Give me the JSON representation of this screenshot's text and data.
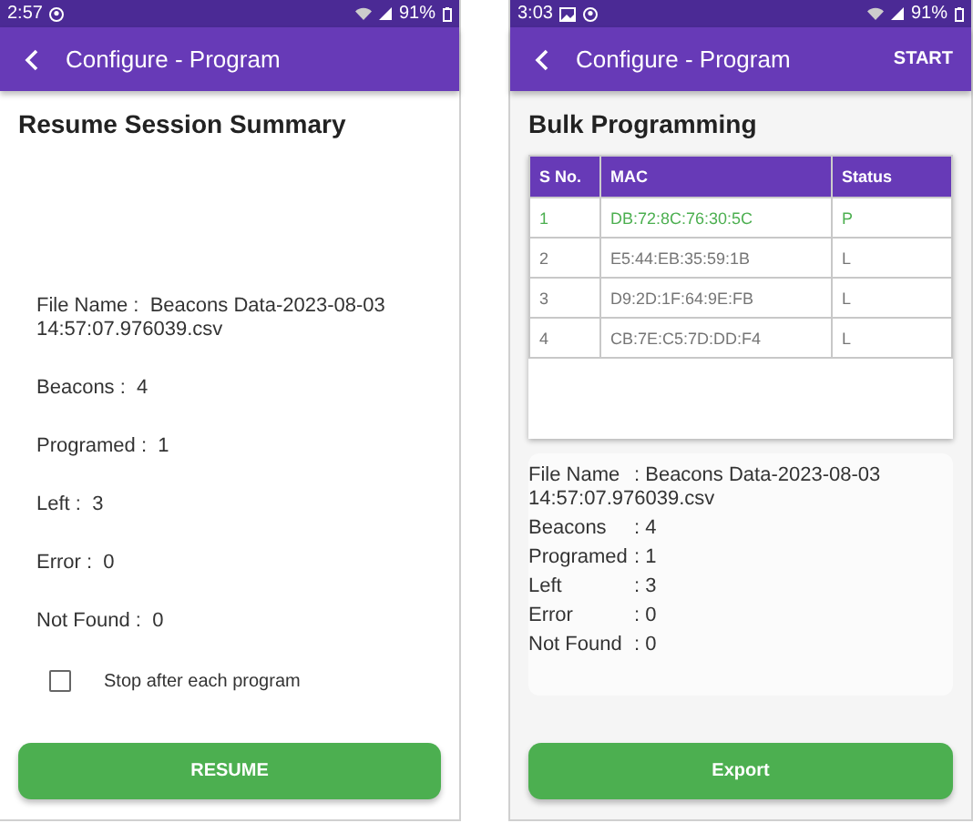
{
  "left_screen": {
    "status_bar": {
      "time": "2:57",
      "battery": "91%"
    },
    "app_bar": {
      "title": "Configure - Program"
    },
    "heading": "Resume Session Summary",
    "summary": [
      {
        "label": "File Name :",
        "value": "Beacons Data-2023-08-03 14:57:07.976039.csv"
      },
      {
        "label": "Beacons :",
        "value": "4"
      },
      {
        "label": "Programed :",
        "value": "1"
      },
      {
        "label": "Left :",
        "value": "3"
      },
      {
        "label": "Error :",
        "value": "0"
      },
      {
        "label": "Not Found :",
        "value": "0"
      }
    ],
    "option": {
      "label": "Stop after each program",
      "checked": false
    },
    "button": "RESUME"
  },
  "right_screen": {
    "status_bar": {
      "time": "3:03",
      "battery": "91%"
    },
    "app_bar": {
      "title": "Configure - Program",
      "action": "START"
    },
    "heading": "Bulk Programming",
    "table": {
      "columns": [
        "S No.",
        "MAC",
        "Status"
      ],
      "rows": [
        {
          "cells": [
            "1",
            "DB:72:8C:76:30:5C",
            "P"
          ],
          "color": "#4caf50"
        },
        {
          "cells": [
            "2",
            "E5:44:EB:35:59:1B",
            "L"
          ],
          "color": "#757575"
        },
        {
          "cells": [
            "3",
            "D9:2D:1F:64:9E:FB",
            "L"
          ],
          "color": "#757575"
        },
        {
          "cells": [
            "4",
            "CB:7E:C5:7D:DD:F4",
            "L"
          ],
          "color": "#757575"
        }
      ]
    },
    "summary": [
      {
        "label": "File Name",
        "value": ": Beacons Data-2023-08-03 14:57:07.976039.csv"
      },
      {
        "label": "Beacons",
        "value": ": 4"
      },
      {
        "label": "Programed",
        "value": ": 1"
      },
      {
        "label": "Left",
        "value": ": 3"
      },
      {
        "label": "Error",
        "value": ": 0"
      },
      {
        "label": "Not Found",
        "value": ": 0"
      }
    ],
    "button": "Export"
  }
}
